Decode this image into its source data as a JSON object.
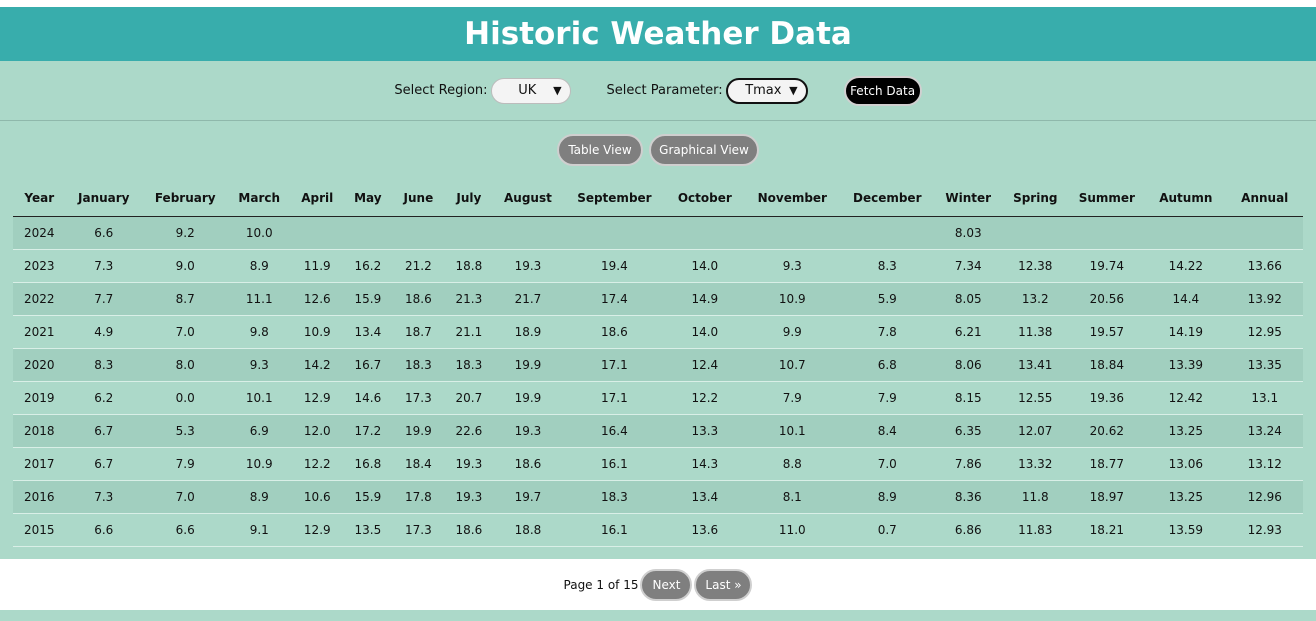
{
  "header": {
    "title": "Historic Weather Data"
  },
  "controls": {
    "region_label": "Select Region:",
    "region_value": "UK",
    "parameter_label": "Select Parameter:",
    "parameter_value": "Tmax",
    "fetch_label": "Fetch Data"
  },
  "views": {
    "table_label": "Table View",
    "graph_label": "Graphical View"
  },
  "table": {
    "columns": [
      "Year",
      "January",
      "February",
      "March",
      "April",
      "May",
      "June",
      "July",
      "August",
      "September",
      "October",
      "November",
      "December",
      "Winter",
      "Spring",
      "Summer",
      "Autumn",
      "Annual"
    ],
    "rows": [
      [
        "2024",
        "6.6",
        "9.2",
        "10.0",
        "",
        "",
        "",
        "",
        "",
        "",
        "",
        "",
        "",
        "8.03",
        "",
        "",
        "",
        ""
      ],
      [
        "2023",
        "7.3",
        "9.0",
        "8.9",
        "11.9",
        "16.2",
        "21.2",
        "18.8",
        "19.3",
        "19.4",
        "14.0",
        "9.3",
        "8.3",
        "7.34",
        "12.38",
        "19.74",
        "14.22",
        "13.66"
      ],
      [
        "2022",
        "7.7",
        "8.7",
        "11.1",
        "12.6",
        "15.9",
        "18.6",
        "21.3",
        "21.7",
        "17.4",
        "14.9",
        "10.9",
        "5.9",
        "8.05",
        "13.2",
        "20.56",
        "14.4",
        "13.92"
      ],
      [
        "2021",
        "4.9",
        "7.0",
        "9.8",
        "10.9",
        "13.4",
        "18.7",
        "21.1",
        "18.9",
        "18.6",
        "14.0",
        "9.9",
        "7.8",
        "6.21",
        "11.38",
        "19.57",
        "14.19",
        "12.95"
      ],
      [
        "2020",
        "8.3",
        "8.0",
        "9.3",
        "14.2",
        "16.7",
        "18.3",
        "18.3",
        "19.9",
        "17.1",
        "12.4",
        "10.7",
        "6.8",
        "8.06",
        "13.41",
        "18.84",
        "13.39",
        "13.35"
      ],
      [
        "2019",
        "6.2",
        "0.0",
        "10.1",
        "12.9",
        "14.6",
        "17.3",
        "20.7",
        "19.9",
        "17.1",
        "12.2",
        "7.9",
        "7.9",
        "8.15",
        "12.55",
        "19.36",
        "12.42",
        "13.1"
      ],
      [
        "2018",
        "6.7",
        "5.3",
        "6.9",
        "12.0",
        "17.2",
        "19.9",
        "22.6",
        "19.3",
        "16.4",
        "13.3",
        "10.1",
        "8.4",
        "6.35",
        "12.07",
        "20.62",
        "13.25",
        "13.24"
      ],
      [
        "2017",
        "6.7",
        "7.9",
        "10.9",
        "12.2",
        "16.8",
        "18.4",
        "19.3",
        "18.6",
        "16.1",
        "14.3",
        "8.8",
        "7.0",
        "7.86",
        "13.32",
        "18.77",
        "13.06",
        "13.12"
      ],
      [
        "2016",
        "7.3",
        "7.0",
        "8.9",
        "10.6",
        "15.9",
        "17.8",
        "19.3",
        "19.7",
        "18.3",
        "13.4",
        "8.1",
        "8.9",
        "8.36",
        "11.8",
        "18.97",
        "13.25",
        "12.96"
      ],
      [
        "2015",
        "6.6",
        "6.6",
        "9.1",
        "12.9",
        "13.5",
        "17.3",
        "18.6",
        "18.8",
        "16.1",
        "13.6",
        "11.0",
        "0.7",
        "6.86",
        "11.83",
        "18.21",
        "13.59",
        "12.93"
      ]
    ]
  },
  "pager": {
    "page_text": "Page 1 of 15",
    "next_label": "Next",
    "last_label": "Last »"
  },
  "colors": {
    "header_bg": "#38adac",
    "panel_bg": "#acd9c9",
    "row_alt": "#a1cfbf",
    "button_bg": "#7f7f7f"
  }
}
